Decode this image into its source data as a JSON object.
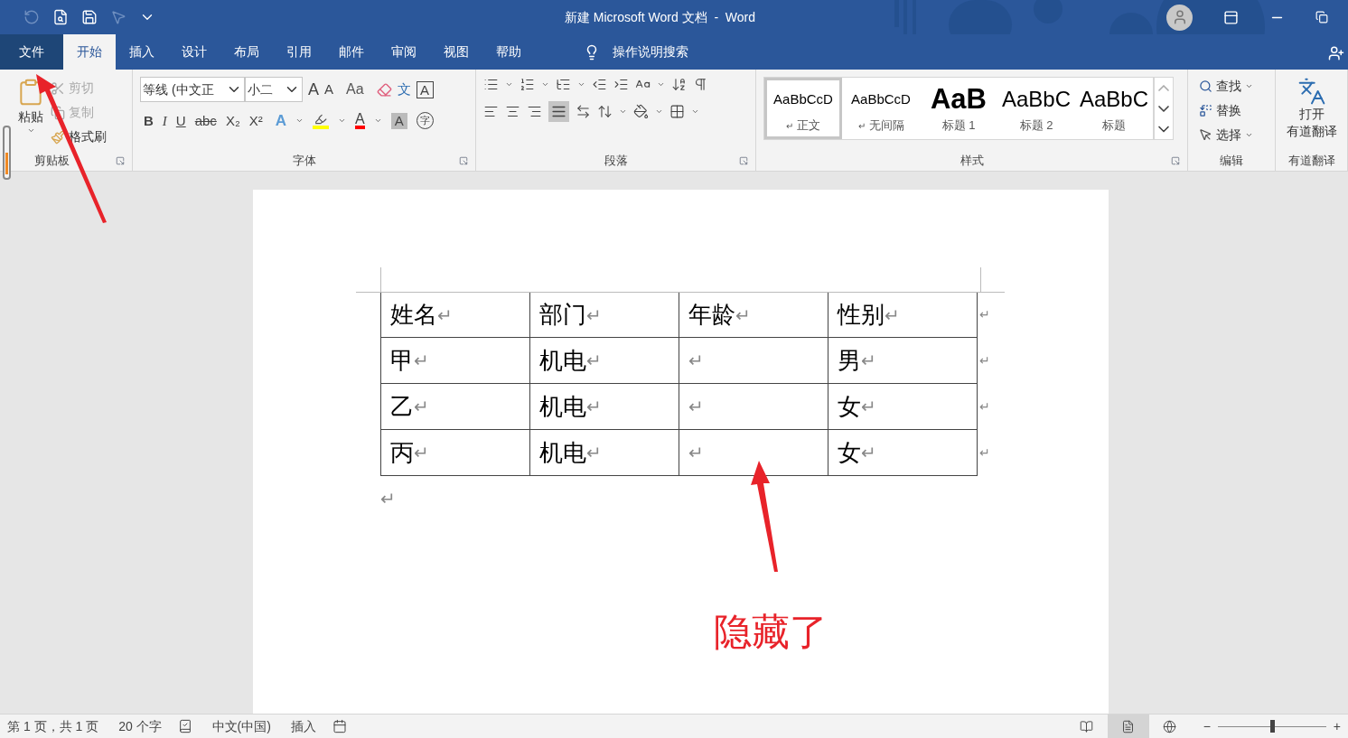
{
  "quick_access": [
    {
      "kind": "undo",
      "disabled": true
    },
    {
      "kind": "print_preview",
      "disabled": false
    },
    {
      "kind": "save",
      "disabled": false
    },
    {
      "kind": "touch",
      "disabled": true
    },
    {
      "kind": "customize",
      "disabled": false
    }
  ],
  "window": {
    "title": "新建 Microsoft Word 文档  -  Word"
  },
  "tabs": [
    {
      "label": "文件",
      "kind": "file",
      "selected": false
    },
    {
      "label": "开始",
      "kind": "tab",
      "selected": true
    },
    {
      "label": "插入",
      "kind": "tab",
      "selected": false
    },
    {
      "label": "设计",
      "kind": "tab",
      "selected": false
    },
    {
      "label": "布局",
      "kind": "tab",
      "selected": false
    },
    {
      "label": "引用",
      "kind": "tab",
      "selected": false
    },
    {
      "label": "邮件",
      "kind": "tab",
      "selected": false
    },
    {
      "label": "审阅",
      "kind": "tab",
      "selected": false
    },
    {
      "label": "视图",
      "kind": "tab",
      "selected": false
    },
    {
      "label": "帮助",
      "kind": "tab",
      "selected": false
    }
  ],
  "tell_me": {
    "placeholder": "操作说明搜索"
  },
  "ribbon": {
    "clipboard": {
      "label": "剪贴板",
      "paste": "粘贴",
      "cut": {
        "label": "剪切",
        "disabled": true
      },
      "copy": {
        "label": "复制",
        "disabled": true
      },
      "format_painter": {
        "label": "格式刷",
        "disabled": false
      }
    },
    "font": {
      "label": "字体",
      "font_name": "等线 (中文正",
      "font_size": "小二",
      "grow": "A",
      "shrink": "A",
      "change_case": "Aa",
      "phonetic": "文",
      "char_border": "A",
      "format_buttons": [
        {
          "label": "B",
          "kind": "bold"
        },
        {
          "label": "I",
          "kind": "italic"
        },
        {
          "label": "U",
          "kind": "underline"
        },
        {
          "label": "abc",
          "kind": "strike"
        },
        {
          "label": "X₂",
          "kind": "sub"
        },
        {
          "label": "X²",
          "kind": "sup"
        }
      ],
      "text_effect": "A",
      "font_color_label": "A",
      "shading": "A",
      "enclose": "字"
    },
    "paragraph": {
      "label": "段落",
      "justify_selected": true
    },
    "styles": {
      "label": "样式",
      "items": [
        {
          "preview": "AaBbCcD",
          "name": "正文",
          "mark": "↵",
          "kind": "normal",
          "selected": true
        },
        {
          "preview": "AaBbCcD",
          "name": "无间隔",
          "mark": "↵",
          "kind": "normal",
          "selected": false
        },
        {
          "preview": "AaB",
          "name": "标题 1",
          "kind": "heading1",
          "selected": false
        },
        {
          "preview": "AaBbC",
          "name": "标题 2",
          "kind": "heading2",
          "selected": false
        },
        {
          "preview": "AaBbC",
          "name": "标题",
          "kind": "title",
          "selected": false
        }
      ]
    },
    "editing": {
      "label": "编辑",
      "find": "查找",
      "replace": "替换",
      "select": "选择"
    },
    "youdao": {
      "label": "有道翻译",
      "button": [
        "打开",
        "有道翻译"
      ]
    }
  },
  "document": {
    "table": {
      "rows": [
        {
          "cells": [
            {
              "text": "姓名",
              "mark": "↵"
            },
            {
              "text": "部门",
              "mark": "↵"
            },
            {
              "text": "年龄",
              "mark": "↵"
            },
            {
              "text": "性别",
              "mark": "↵"
            }
          ],
          "end_mark": "↵"
        },
        {
          "cells": [
            {
              "text": "甲",
              "mark": "↵"
            },
            {
              "text": "机电",
              "mark": "↵"
            },
            {
              "mark": "↵"
            },
            {
              "text": "男",
              "mark": "↵"
            }
          ],
          "end_mark": "↵"
        },
        {
          "cells": [
            {
              "text": "乙",
              "mark": "↵"
            },
            {
              "text": "机电",
              "mark": "↵"
            },
            {
              "mark": "↵"
            },
            {
              "text": "女",
              "mark": "↵"
            }
          ],
          "end_mark": "↵"
        },
        {
          "cells": [
            {
              "text": "丙",
              "mark": "↵"
            },
            {
              "text": "机电",
              "mark": "↵"
            },
            {
              "mark": "↵"
            },
            {
              "text": "女",
              "mark": "↵"
            }
          ],
          "end_mark": "↵"
        }
      ]
    },
    "after_mark": "↵"
  },
  "annotation": {
    "text": "隐藏了"
  },
  "status_bar": {
    "page": "第 1 页，共 1 页",
    "words": "20 个字",
    "language": "中文(中国)",
    "mode": "插入",
    "views": [
      {
        "kind": "read",
        "selected": false
      },
      {
        "kind": "print",
        "selected": true
      },
      {
        "kind": "web",
        "selected": false
      }
    ],
    "zoom": {
      "level": 0.5,
      "minus": "−",
      "plus": "+"
    }
  }
}
